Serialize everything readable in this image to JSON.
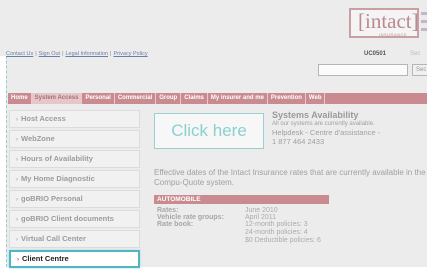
{
  "logo": {
    "brand": "[intact]",
    "sub": "INSURANCE"
  },
  "top_links": [
    "Contact Us",
    "Sign Out",
    "Legal Information",
    "Privacy Policy"
  ],
  "user": {
    "id": "UC0501",
    "button": "Sec"
  },
  "nav_tabs": [
    "Home",
    "System Access",
    "Personal",
    "Commercial",
    "Group",
    "Claims",
    "My insurer and me",
    "Prevention",
    "Web"
  ],
  "sidebar": [
    "Host Access",
    "WebZone",
    "Hours of Availability",
    "My Home Diagnostic",
    "goBRIO Personal",
    "goBRIO Client documents",
    "Virtual Call Center",
    "Client Centre"
  ],
  "click_here": "Click here",
  "systems": {
    "title": "Systems Availability",
    "line1": "All our systems are currently available.",
    "line2": "Helpdesk - Centre d'assistance -",
    "line3": "1 877 464 2433"
  },
  "effective_text": "Effective dates of the Intact Insurance rates that are currently available in the Compu-Quote system.",
  "automobile": {
    "header": "AUTOMOBILE",
    "rows": [
      {
        "label": "Rates:",
        "value": "June 2010"
      },
      {
        "label": "Vehicle rate groups:",
        "value": "April 2011"
      },
      {
        "label": "Rate book:",
        "value": "12-month policies: 3",
        "value2": "24-month policies: 4",
        "value3": "$0 Deductible policies: 6"
      }
    ]
  }
}
